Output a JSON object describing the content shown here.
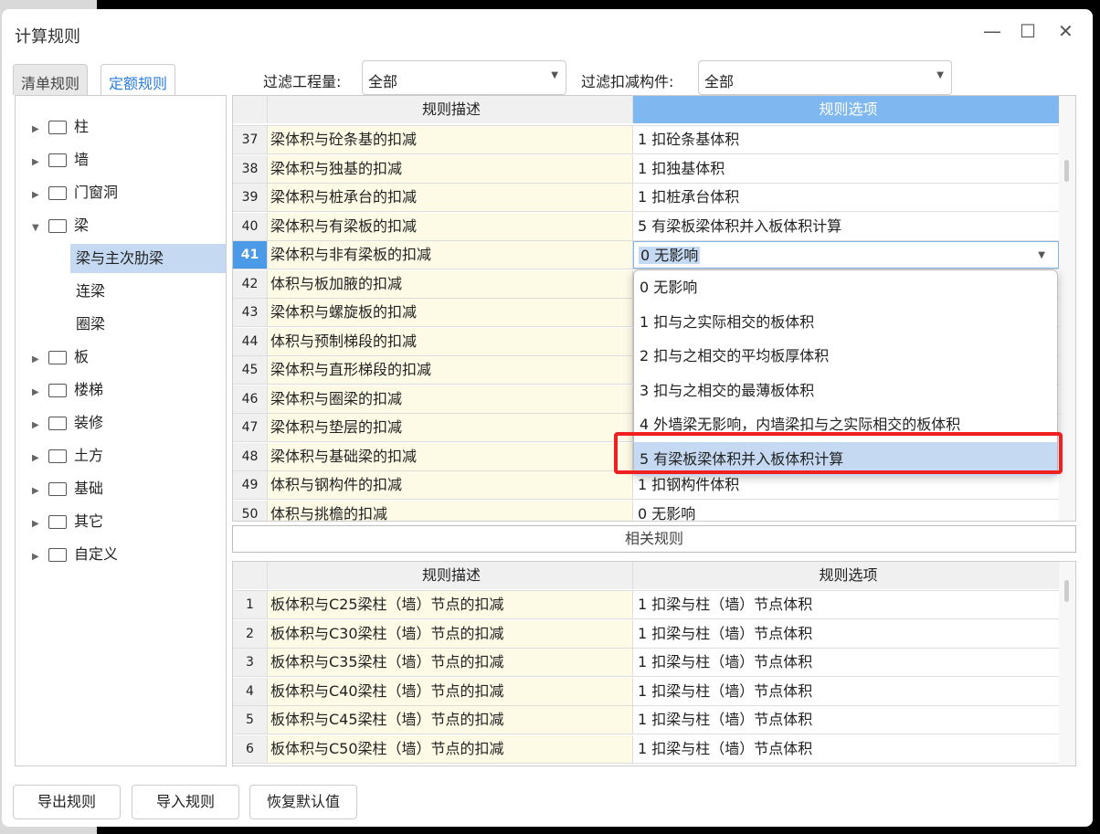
{
  "window": {
    "title": "计算规则",
    "minimize": "—",
    "maximize": "☐",
    "close": "✕"
  },
  "tabs": [
    {
      "label": "清单规则",
      "active": false
    },
    {
      "label": "定额规则",
      "active": true
    }
  ],
  "filters": {
    "quantity_label": "过滤工程量:",
    "quantity_value": "全部",
    "deduct_label": "过滤扣减构件:",
    "deduct_value": "全部"
  },
  "tree": [
    {
      "label": "柱",
      "type": "folder",
      "expanded": false
    },
    {
      "label": "墙",
      "type": "folder",
      "expanded": false
    },
    {
      "label": "门窗洞",
      "type": "folder",
      "expanded": false
    },
    {
      "label": "梁",
      "type": "folder",
      "expanded": true
    },
    {
      "label": "梁与主次肋梁",
      "type": "child",
      "selected": true
    },
    {
      "label": "连梁",
      "type": "child"
    },
    {
      "label": "圈梁",
      "type": "child"
    },
    {
      "label": "板",
      "type": "folder",
      "expanded": false
    },
    {
      "label": "楼梯",
      "type": "folder",
      "expanded": false
    },
    {
      "label": "装修",
      "type": "folder",
      "expanded": false
    },
    {
      "label": "土方",
      "type": "folder",
      "expanded": false
    },
    {
      "label": "基础",
      "type": "folder",
      "expanded": false
    },
    {
      "label": "其它",
      "type": "folder",
      "expanded": false
    },
    {
      "label": "自定义",
      "type": "folder",
      "expanded": false
    }
  ],
  "main_grid": {
    "headers": [
      "规则描述",
      "规则选项"
    ],
    "rows": [
      [
        "37",
        "梁体积与砼条基的扣减",
        "1  扣砼条基体积"
      ],
      [
        "38",
        "梁体积与独基的扣减",
        "1  扣独基体积"
      ],
      [
        "39",
        "梁体积与桩承台的扣减",
        "1  扣桩承台体积"
      ],
      [
        "40",
        "梁体积与有梁板的扣减",
        "5  有梁板梁体积并入板体积计算"
      ],
      [
        "41",
        "梁体积与非有梁板的扣减",
        "0  无影响"
      ],
      [
        "42",
        "体积与板加腋的扣减",
        ""
      ],
      [
        "43",
        "梁体积与螺旋板的扣减",
        ""
      ],
      [
        "44",
        "体积与预制梯段的扣减",
        ""
      ],
      [
        "45",
        "梁体积与直形梯段的扣减",
        ""
      ],
      [
        "46",
        "梁体积与圈梁的扣减",
        ""
      ],
      [
        "47",
        "梁体积与垫层的扣减",
        ""
      ],
      [
        "48",
        "梁体积与基础梁的扣减",
        ""
      ],
      [
        "49",
        "体积与钢构件的扣减",
        "1  扣钢构件体积"
      ],
      [
        "50",
        "体积与挑檐的扣减",
        "0  无影响"
      ]
    ],
    "selected_row": "41"
  },
  "dropdown": {
    "options": [
      "0  无影响",
      "1 扣与之实际相交的板体积",
      "2 扣与之相交的平均板厚体积",
      "3 扣与之相交的最薄板体积",
      "4 外墙梁无影响，内墙梁扣与之实际相交的板体积",
      "5 有梁板梁体积并入板体积计算"
    ],
    "highlighted": "5 有梁板梁体积并入板体积计算",
    "highlight_color": "#c5daf2",
    "annotation_color": "#f02020"
  },
  "related": {
    "title": "相关规则",
    "headers": [
      "规则描述",
      "规则选项"
    ],
    "rows": [
      [
        "1",
        "板体积与C25梁柱（墙）节点的扣减",
        "1  扣梁与柱（墙）节点体积"
      ],
      [
        "2",
        "板体积与C30梁柱（墙）节点的扣减",
        "1  扣梁与柱（墙）节点体积"
      ],
      [
        "3",
        "板体积与C35梁柱（墙）节点的扣减",
        "1  扣梁与柱（墙）节点体积"
      ],
      [
        "4",
        "板体积与C40梁柱（墙）节点的扣减",
        "1  扣梁与柱（墙）节点体积"
      ],
      [
        "5",
        "板体积与C45梁柱（墙）节点的扣减",
        "1  扣梁与柱（墙）节点体积"
      ],
      [
        "6",
        "板体积与C50梁柱（墙）节点的扣减",
        "1  扣梁与柱（墙）节点体积"
      ]
    ]
  },
  "buttons": {
    "export": "导出规则",
    "import": "导入规则",
    "reset": "恢复默认值"
  },
  "colors": {
    "accent": "#2a7de1",
    "header_selected": "#7fb7f0",
    "desc_bg": "#fdfbe6"
  }
}
